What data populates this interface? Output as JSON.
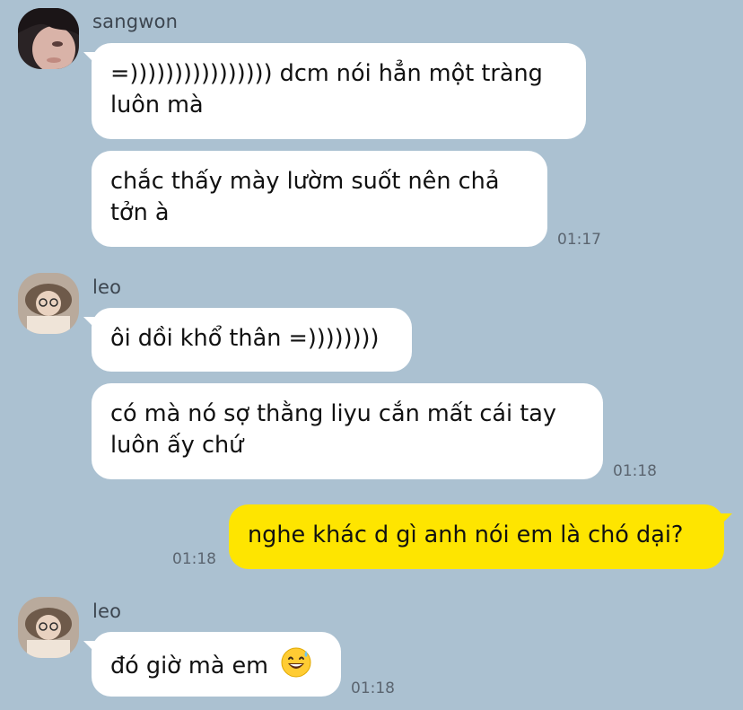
{
  "messages": {
    "group1": {
      "sender": "sangwon",
      "bubble1": {
        "line1": "=)))))))))))))))) dcm nói hẳn một tràng",
        "line2": "luôn mà"
      },
      "bubble2": {
        "line1": "chắc thấy mày lườm suốt nên chả",
        "line2": "tởn à"
      },
      "time": "01:17"
    },
    "group2": {
      "sender": "leo",
      "bubble1": {
        "line1": "ôi dồi khổ thân =))))))))"
      },
      "bubble2": {
        "line1": "có mà nó sợ thằng liyu cắn mất cái tay",
        "line2": "luôn ấy chứ"
      },
      "time": "01:18"
    },
    "mine": {
      "text": "nghe khác d gì anh nói em là chó dại?",
      "time": "01:18"
    },
    "group3": {
      "sender": "leo",
      "bubble1": {
        "text": "đó giờ mà em",
        "emoji": "grinning-sweat-emoji"
      },
      "time": "01:18"
    }
  },
  "colors": {
    "background": "#abc1d1",
    "incoming_bubble": "#ffffff",
    "outgoing_bubble": "#fee500",
    "timestamp": "#5b6570"
  }
}
